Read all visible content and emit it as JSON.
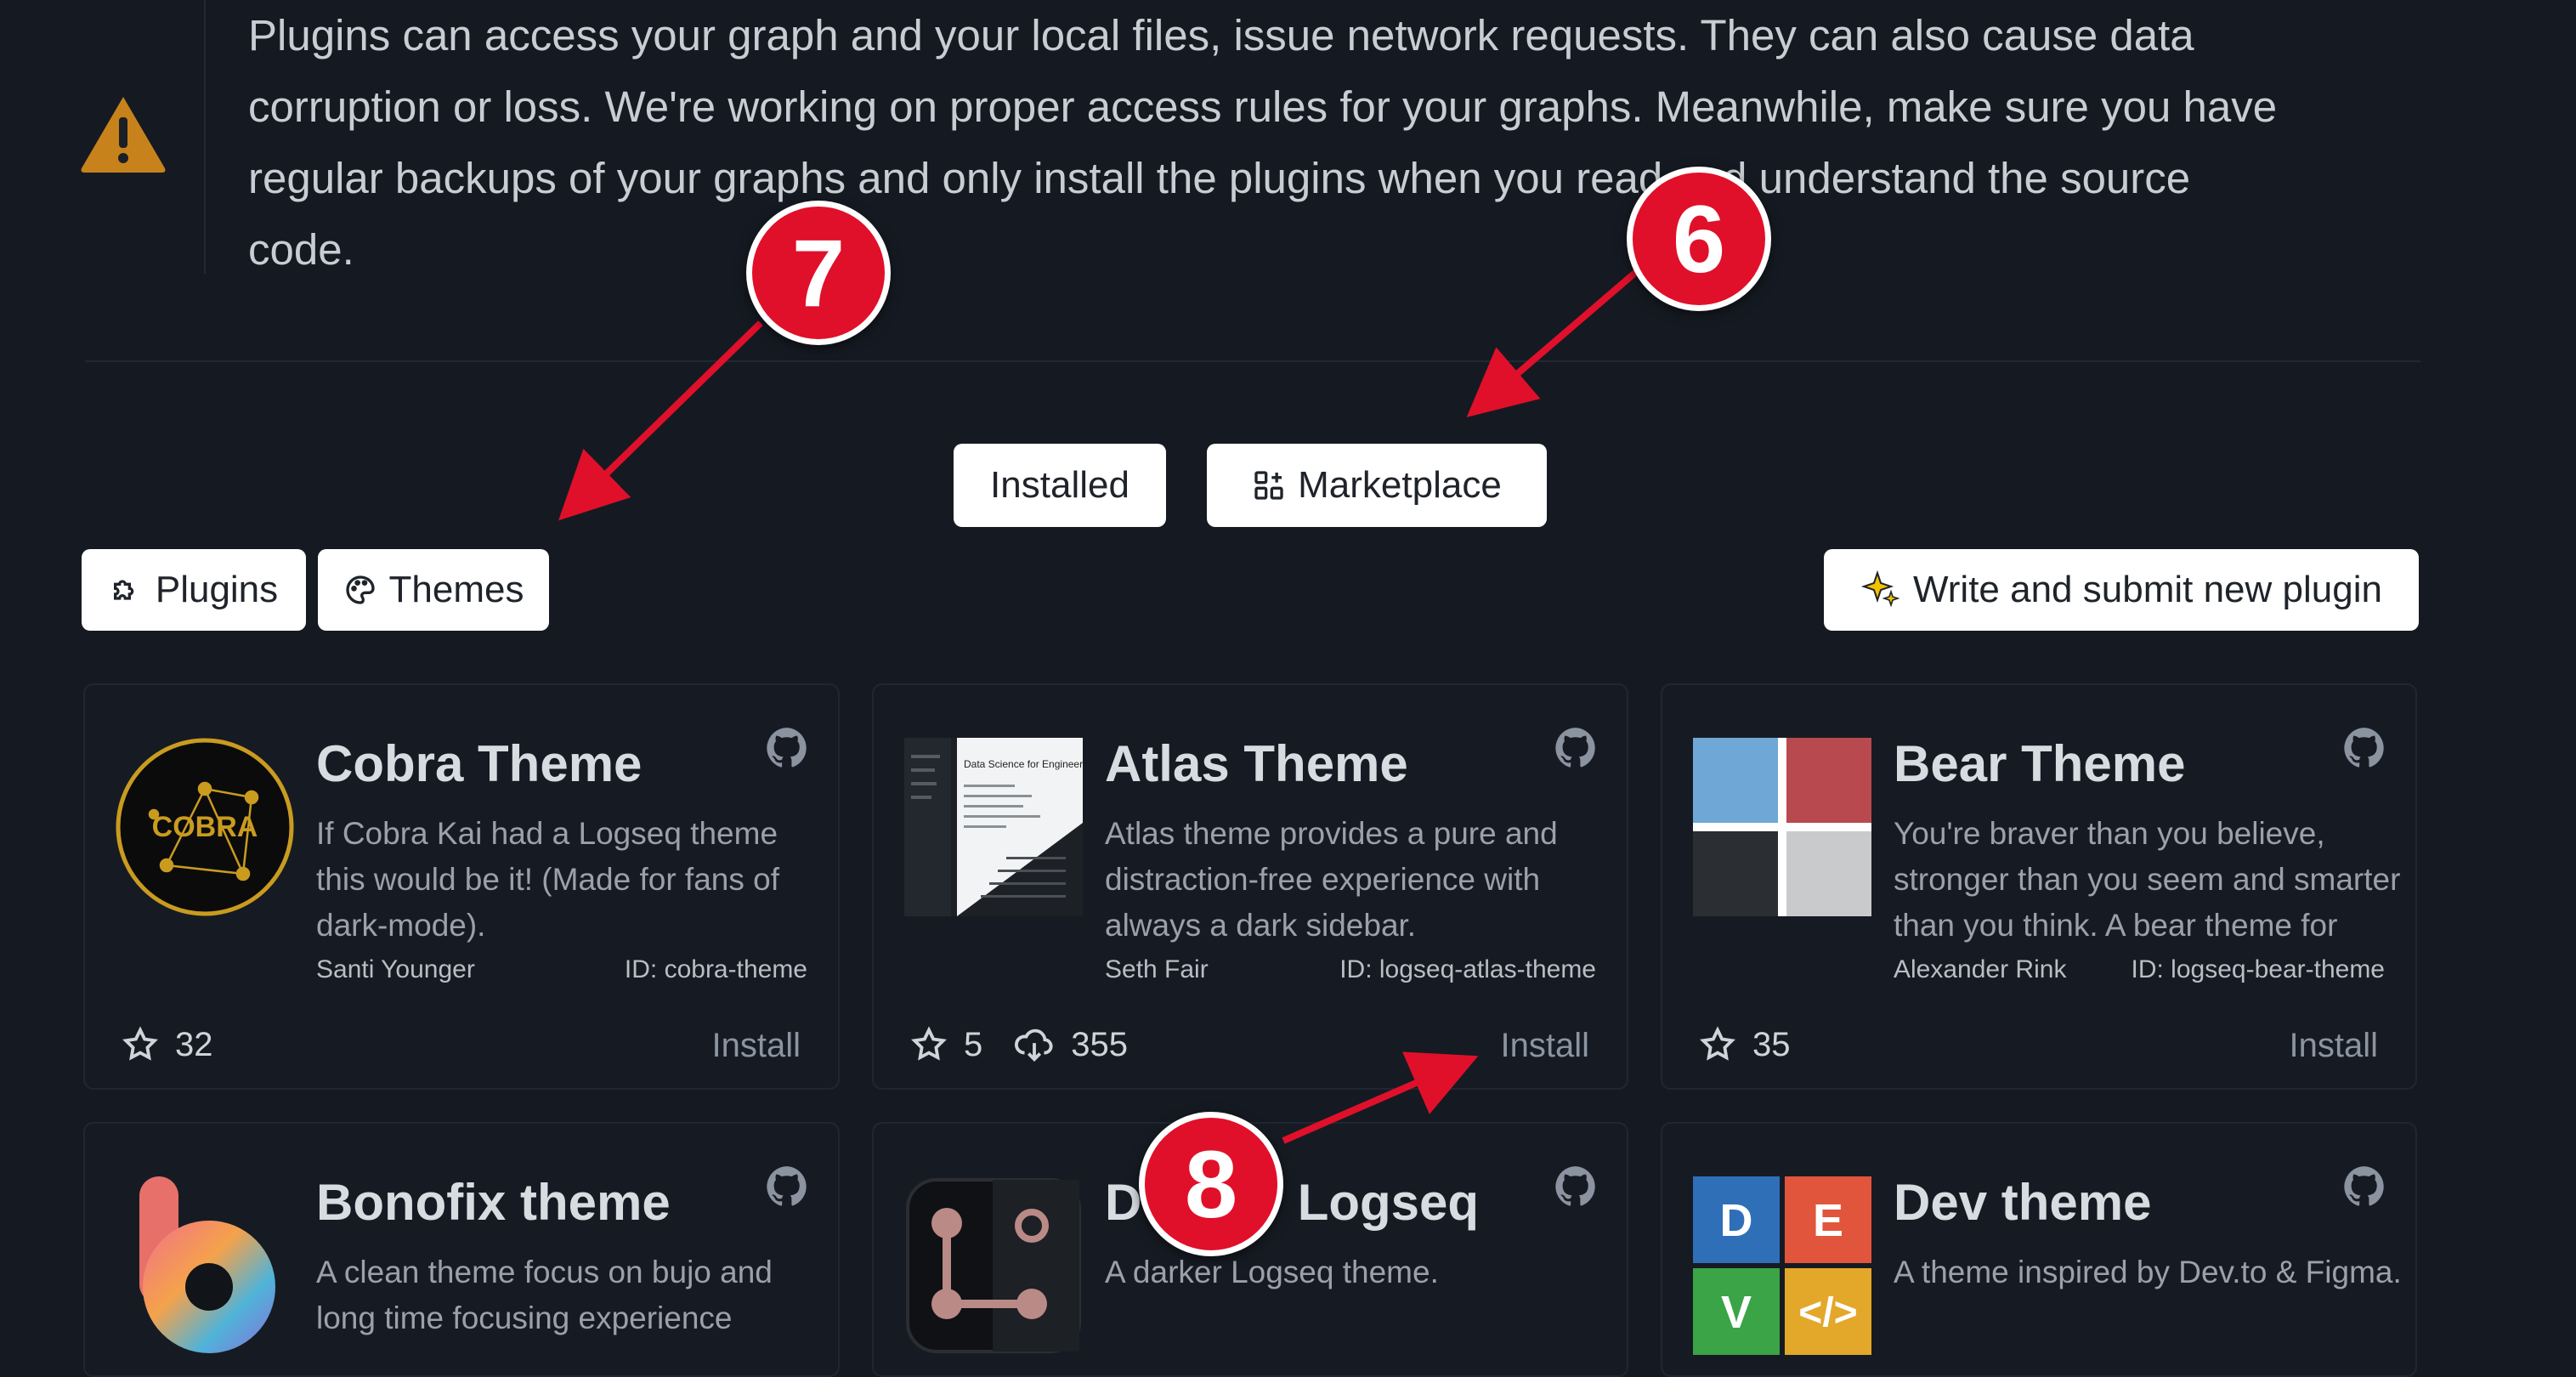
{
  "warning": {
    "icon": "warning-triangle-icon",
    "lines": [
      "Plugins can access your graph and your local files, issue network requests. They can also cause data",
      "corruption or loss. We're working on proper access rules for your graphs. Meanwhile, make sure you have",
      "regular backups of your graphs and only install the plugins when you read and understand the source",
      "code."
    ]
  },
  "tabs": {
    "installed_label": "Installed",
    "marketplace_label": "Marketplace"
  },
  "filters": {
    "plugins_label": "Plugins",
    "themes_label": "Themes"
  },
  "submit_label": "Write and submit new plugin",
  "cards": [
    {
      "title": "Cobra Theme",
      "description": "If Cobra Kai had a Logseq theme this would be it! (Made for fans of dark-mode).",
      "author": "Santi Younger",
      "id": "ID: cobra-theme",
      "stars": "32",
      "downloads": "",
      "install": "Install"
    },
    {
      "title": "Atlas Theme",
      "description": "Atlas theme provides a pure and distraction-free experience with always a dark sidebar.",
      "author": "Seth Fair",
      "id": "ID: logseq-atlas-theme",
      "stars": "5",
      "downloads": "355",
      "install": "Install"
    },
    {
      "title": "Bear Theme",
      "description": "You're braver than you believe, stronger than you seem and smarter than you think. A bear theme for",
      "author": "Alexander Rink",
      "id": "ID: logseq-bear-theme",
      "stars": "35",
      "downloads": "",
      "install": "Install"
    },
    {
      "title": "Bonofix theme",
      "description": "A clean theme focus on bujo and long time focusing experience"
    },
    {
      "title": "D           Logseq",
      "description": "A darker Logseq theme."
    },
    {
      "title": "Dev theme",
      "description": "A theme inspired by Dev.to & Figma."
    }
  ],
  "logo_text": {
    "cobra": "COBRA",
    "dev": [
      "D",
      "E",
      "V",
      "</>"
    ],
    "atlas_doc": "Data Science for Engineers"
  },
  "markers": [
    "7",
    "6",
    "8"
  ],
  "colors": {
    "background": "#151a22",
    "card_border": "#202732",
    "marker": "#e0102a",
    "warning": "#c7821c"
  }
}
